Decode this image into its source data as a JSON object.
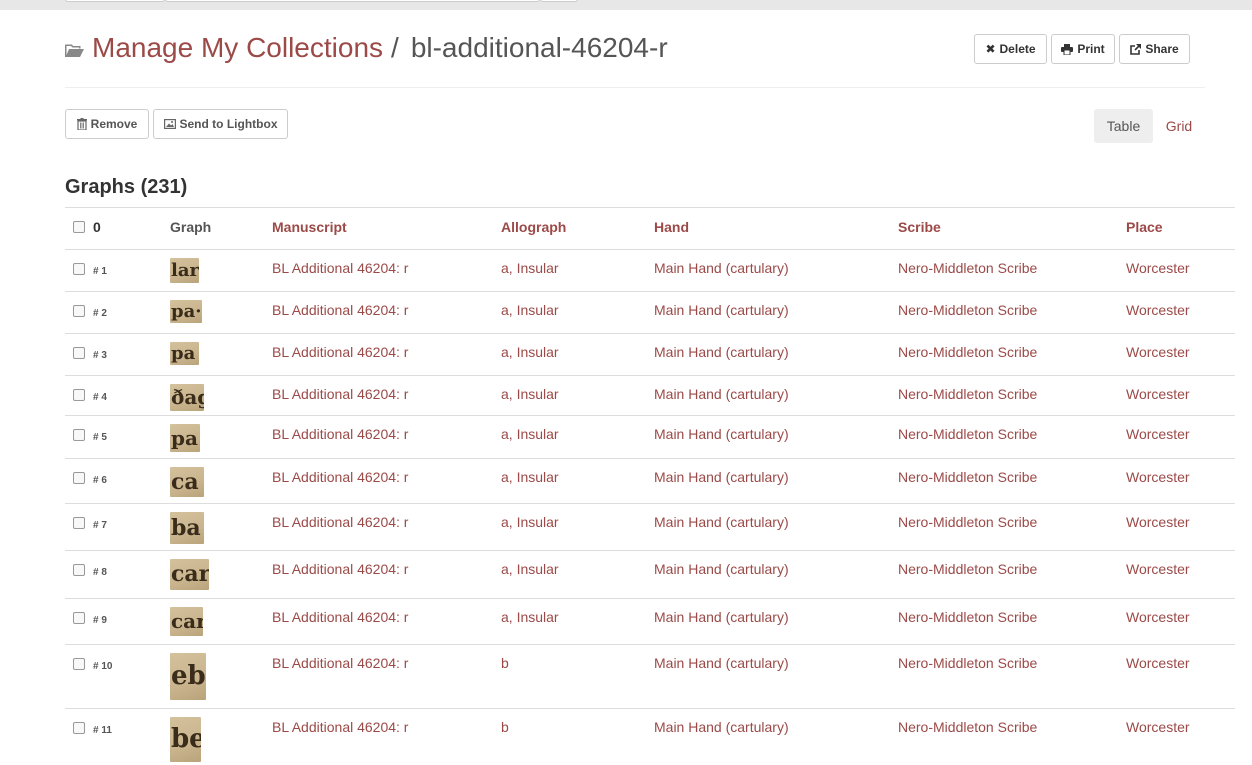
{
  "header": {
    "breadcrumb_link": "Manage My Collections",
    "separator": "/",
    "collection_name": "bl-additional-46204-r",
    "delete_label": "Delete",
    "print_label": "Print",
    "share_label": "Share"
  },
  "toolbar": {
    "remove_label": "Remove",
    "lightbox_label": "Send to Lightbox",
    "view_table": "Table",
    "view_grid": "Grid"
  },
  "section": {
    "title": "Graphs (231)"
  },
  "table": {
    "select_count": "0",
    "columns": {
      "graph": "Graph",
      "manuscript": "Manuscript",
      "allograph": "Allograph",
      "hand": "Hand",
      "scribe": "Scribe",
      "place": "Place"
    },
    "rows": [
      {
        "num": "# 1",
        "thumb_text": "lar",
        "manuscript": "BL Additional 46204: r",
        "allograph": "a, Insular",
        "hand": "Main Hand (cartulary)",
        "scribe": "Nero-Middleton Scribe",
        "place": "Worcester"
      },
      {
        "num": "# 2",
        "thumb_text": "pa·",
        "manuscript": "BL Additional 46204: r",
        "allograph": "a, Insular",
        "hand": "Main Hand (cartulary)",
        "scribe": "Nero-Middleton Scribe",
        "place": "Worcester"
      },
      {
        "num": "# 3",
        "thumb_text": "pa",
        "manuscript": "BL Additional 46204: r",
        "allograph": "a, Insular",
        "hand": "Main Hand (cartulary)",
        "scribe": "Nero-Middleton Scribe",
        "place": "Worcester"
      },
      {
        "num": "# 4",
        "thumb_text": "ðag",
        "manuscript": "BL Additional 46204: r",
        "allograph": "a, Insular",
        "hand": "Main Hand (cartulary)",
        "scribe": "Nero-Middleton Scribe",
        "place": "Worcester"
      },
      {
        "num": "# 5",
        "thumb_text": "pa",
        "manuscript": "BL Additional 46204: r",
        "allograph": "a, Insular",
        "hand": "Main Hand (cartulary)",
        "scribe": "Nero-Middleton Scribe",
        "place": "Worcester"
      },
      {
        "num": "# 6",
        "thumb_text": "ca",
        "manuscript": "BL Additional 46204: r",
        "allograph": "a, Insular",
        "hand": "Main Hand (cartulary)",
        "scribe": "Nero-Middleton Scribe",
        "place": "Worcester"
      },
      {
        "num": "# 7",
        "thumb_text": "ba",
        "manuscript": "BL Additional 46204: r",
        "allograph": "a, Insular",
        "hand": "Main Hand (cartulary)",
        "scribe": "Nero-Middleton Scribe",
        "place": "Worcester"
      },
      {
        "num": "# 8",
        "thumb_text": "car",
        "manuscript": "BL Additional 46204: r",
        "allograph": "a, Insular",
        "hand": "Main Hand (cartulary)",
        "scribe": "Nero-Middleton Scribe",
        "place": "Worcester"
      },
      {
        "num": "# 9",
        "thumb_text": "car",
        "manuscript": "BL Additional 46204: r",
        "allograph": "a, Insular",
        "hand": "Main Hand (cartulary)",
        "scribe": "Nero-Middleton Scribe",
        "place": "Worcester"
      },
      {
        "num": "# 10",
        "thumb_text": "ebe",
        "manuscript": "BL Additional 46204: r",
        "allograph": "b",
        "hand": "Main Hand (cartulary)",
        "scribe": "Nero-Middleton Scribe",
        "place": "Worcester"
      },
      {
        "num": "# 11",
        "thumb_text": "be",
        "manuscript": "BL Additional 46204: r",
        "allograph": "b",
        "hand": "Main Hand (cartulary)",
        "scribe": "Nero-Middleton Scribe",
        "place": "Worcester"
      }
    ]
  },
  "colors": {
    "link": "#9b4a48",
    "parchment": "#c9b48e"
  }
}
